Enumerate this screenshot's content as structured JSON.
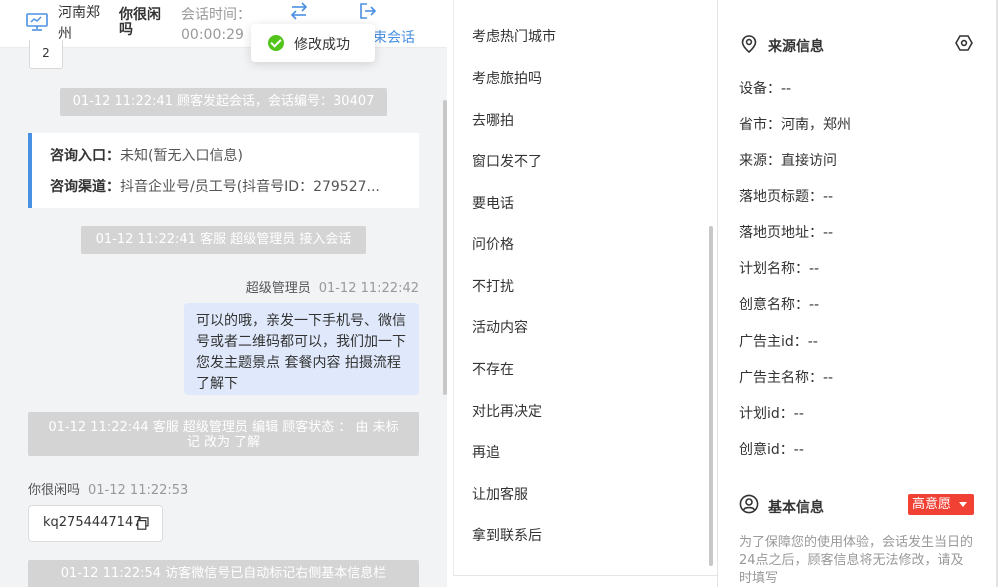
{
  "header": {
    "location": "河南郑州",
    "visitor_name": "你很闲吗",
    "session_time_label": "会话时间：",
    "session_time": "00:00:29",
    "end_session_label": "束会话"
  },
  "toast": {
    "text": "修改成功"
  },
  "page_indicator": "2",
  "chat": {
    "sys_start": "01-12 11:22:41 顾客发起会话，会话编号：30407",
    "entry": {
      "entry_label": "咨询入口：",
      "entry_value": "未知(暂无入口信息)",
      "channel_label": "咨询渠道：",
      "channel_value": "抖音企业号/员工号(抖音号ID：279527..."
    },
    "sys_join": "01-12 11:22:41 客服 超级管理员 接入会话",
    "agent_name": "超级管理员",
    "agent_time": "01-12 11:22:42",
    "agent_message": "可以的哦，亲发一下手机号、微信号或者二维码都可以，我们加一下您发主题景点 套餐内容 拍摄流程了解下",
    "sys_edit": "01-12 11:22:44 客服 超级管理员 编辑 顾客状态 ： 由 未标记 改为 了解",
    "customer_name": "你很闲吗",
    "customer_time": "01-12 11:22:53",
    "customer_message": "kq2754447147",
    "sys_wechat": "01-12 11:22:54 访客微信号已自动标记右侧基本信息栏"
  },
  "quick_replies": [
    "考虑热门城市",
    "考虑旅拍吗",
    "去哪拍",
    "窗口发不了",
    "要电话",
    "问价格",
    "不打扰",
    "活动内容",
    "不存在",
    "对比再决定",
    "再追",
    "让加客服",
    "拿到联系后"
  ],
  "source_info": {
    "title": "来源信息",
    "fields": [
      "设备：--",
      "省市：河南，郑州",
      "来源：直接访问",
      "落地页标题：--",
      "落地页地址：--",
      "计划名称：--",
      "创意名称：--",
      "广告主id：--",
      "广告主名称：--",
      "计划id：--",
      "创意id：--"
    ]
  },
  "basic_info": {
    "title": "基本信息",
    "intent_badge": "高意愿",
    "notice": "为了保障您的使用体验，会话发生当日的24点之后，顾客信息将无法修改，请及时填写"
  },
  "colors": {
    "accent": "#4a90e2",
    "badge": "#f04134",
    "success": "#52c41a",
    "agent_bubble": "#dfe9fb"
  }
}
